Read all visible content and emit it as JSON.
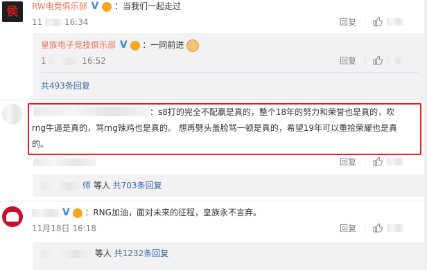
{
  "comment1": {
    "author": "RW电竞俱乐部",
    "text": "：当我们一起走过",
    "time_prefix": "11",
    "time": "16:34",
    "reply_label": "回复"
  },
  "subreply1": {
    "author": "皇族电子竞技俱乐部",
    "text": "：一同前进",
    "time_prefix": "1",
    "time": "16:52",
    "reply_label": "回复"
  },
  "total1": "共493条回复",
  "comment2": {
    "text_line1": "：s8打的完全不配赢是真的，整个18年的努力和荣誉也是真的，吹",
    "text_line2": "rng牛逼是真的，骂rng辣鸡也是真的。 想再劈头盖脸骂一顿是真的，希望19年可以重拾荣耀也是真",
    "text_line3": "的。",
    "reply_label": "回复",
    "summary_suffix": "师",
    "summary_etc": " 等人",
    "summary_count": "共703条回复"
  },
  "comment3": {
    "text": "：RNG加油，面对未来的征程，皇族永不言弃。",
    "time": "11月18日 16:18",
    "reply_label": "回复",
    "summary_etc": "等人",
    "summary_count": "共1232条回复"
  },
  "icons": [
    "verified-v-icon",
    "vip-badge-icon",
    "thumbs-up-icon",
    "fist-emoji-icon"
  ],
  "colors": {
    "link": "#eb7350",
    "blue_link": "#3e6aa7",
    "highlight_box": "#e02020",
    "panel": "#f2f2f5"
  }
}
